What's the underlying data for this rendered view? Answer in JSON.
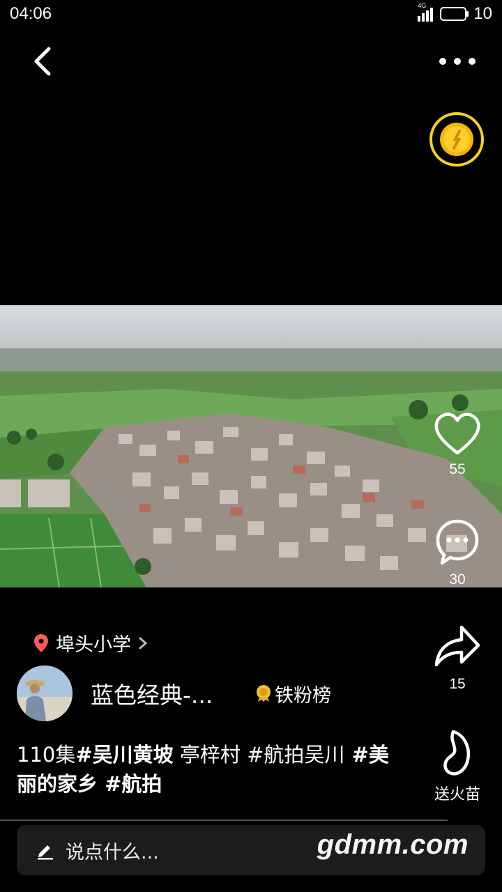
{
  "status_bar": {
    "time": "04:06",
    "network": "4G",
    "battery": "10"
  },
  "video": {
    "location": "埠头小学"
  },
  "actions": {
    "like_count": "55",
    "comment_count": "30",
    "share_count": "15",
    "gift_label": "送火苗"
  },
  "author": {
    "name": "蓝色经典-...",
    "fans_badge": "铁粉榜"
  },
  "caption": {
    "prefix": "110集",
    "tag1": "#吴川黄坡",
    "text1": " 亭梓村 ",
    "tag2": "#航拍吴川",
    "tag3": " #美丽的家乡",
    "tag4": " #航拍"
  },
  "comment_input": {
    "placeholder": "说点什么..."
  },
  "watermark": "gdmm.com",
  "colors": {
    "coin_ring": "#f5d21b",
    "location_pin": "#ff5a5a",
    "comment_bar": "#1c1c1c"
  }
}
